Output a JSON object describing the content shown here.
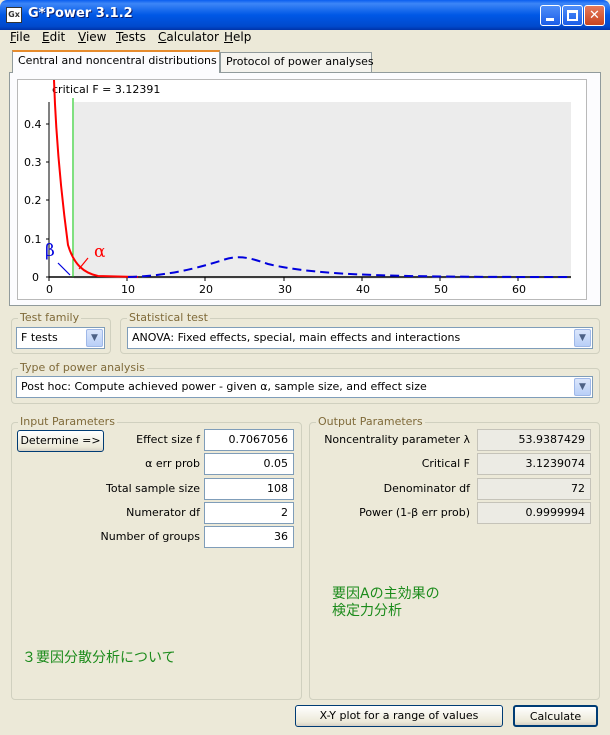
{
  "window": {
    "title": "G*Power 3.1.2",
    "icon": "gpower-app-icon"
  },
  "menu": [
    "File",
    "Edit",
    "View",
    "Tests",
    "Calculator",
    "Help"
  ],
  "tabs": [
    {
      "label": "Central and noncentral distributions",
      "active": true
    },
    {
      "label": "Protocol of power analyses",
      "active": false
    }
  ],
  "plot": {
    "critical_label": "critical F = 3.12391",
    "alpha_symbol": "α",
    "beta_symbol": "β",
    "y_ticks": [
      "0.4",
      "0.3",
      "0.2",
      "0.1",
      "0"
    ],
    "x_ticks": [
      "0",
      "10",
      "20",
      "30",
      "40",
      "50",
      "60"
    ],
    "colors": {
      "central": "#ff0000",
      "noncentral": "#0000ff",
      "critical": "#00c000",
      "background": "#ececec"
    }
  },
  "test_family": {
    "label": "Test family",
    "value": "F tests"
  },
  "statistical_test": {
    "label": "Statistical test",
    "value": "ANOVA: Fixed effects, special, main effects and interactions"
  },
  "power_analysis": {
    "label": "Type of power analysis",
    "value": "Post hoc: Compute achieved power - given α, sample size, and effect size"
  },
  "input": {
    "label": "Input Parameters",
    "determine_label": "Determine =>",
    "rows": [
      {
        "label": "Effect size f",
        "value": "0.7067056"
      },
      {
        "label": "α err prob",
        "value": "0.05"
      },
      {
        "label": "Total sample size",
        "value": "108"
      },
      {
        "label": "Numerator df",
        "value": "2"
      },
      {
        "label": "Number of groups",
        "value": "36"
      }
    ]
  },
  "output": {
    "label": "Output Parameters",
    "rows": [
      {
        "label": "Noncentrality parameter λ",
        "value": "53.9387429"
      },
      {
        "label": "Critical F",
        "value": "3.1239074"
      },
      {
        "label": "Denominator df",
        "value": "72"
      },
      {
        "label": "Power (1-β err prob)",
        "value": "0.9999994"
      }
    ]
  },
  "notes": {
    "main_effect_line1": "要因Aの主効果の",
    "main_effect_line2": "検定力分析",
    "three_factor": "３要因分散分析について",
    "color": "#1b8b1b"
  },
  "buttons": {
    "xy_plot": "X-Y plot for a range of values",
    "calculate": "Calculate"
  }
}
